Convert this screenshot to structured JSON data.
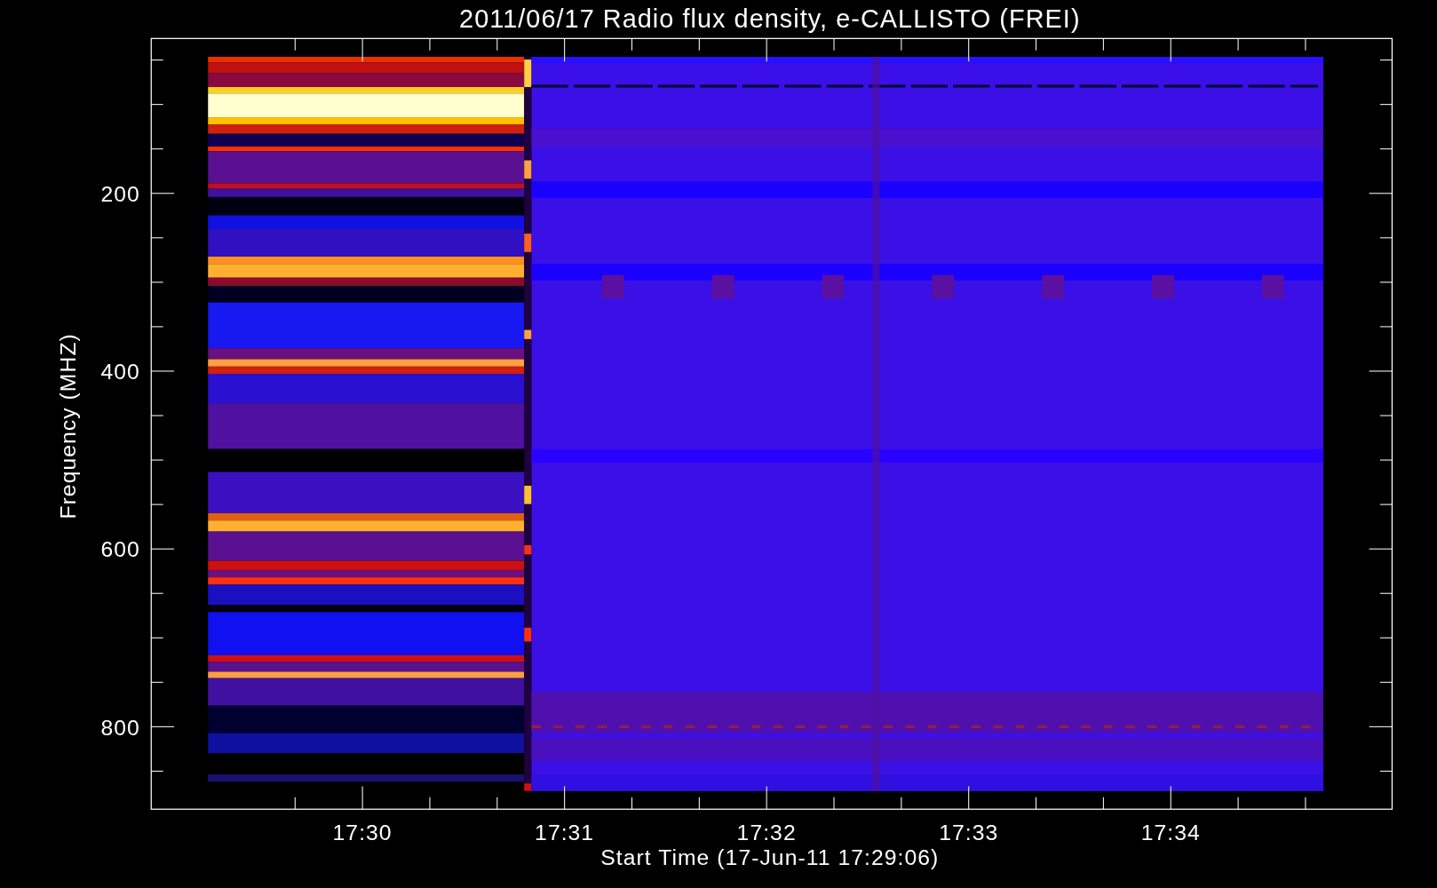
{
  "title": "2011/06/17  Radio flux density, e-CALLISTO (FREI)",
  "y_axis": {
    "title": "Frequency (MHZ)",
    "tick_labels": [
      "200",
      "400",
      "600",
      "800"
    ]
  },
  "x_axis": {
    "title": "Start Time (17-Jun-11 17:29:06)",
    "tick_labels": [
      "17:30",
      "17:31",
      "17:32",
      "17:33",
      "17:34"
    ]
  }
}
